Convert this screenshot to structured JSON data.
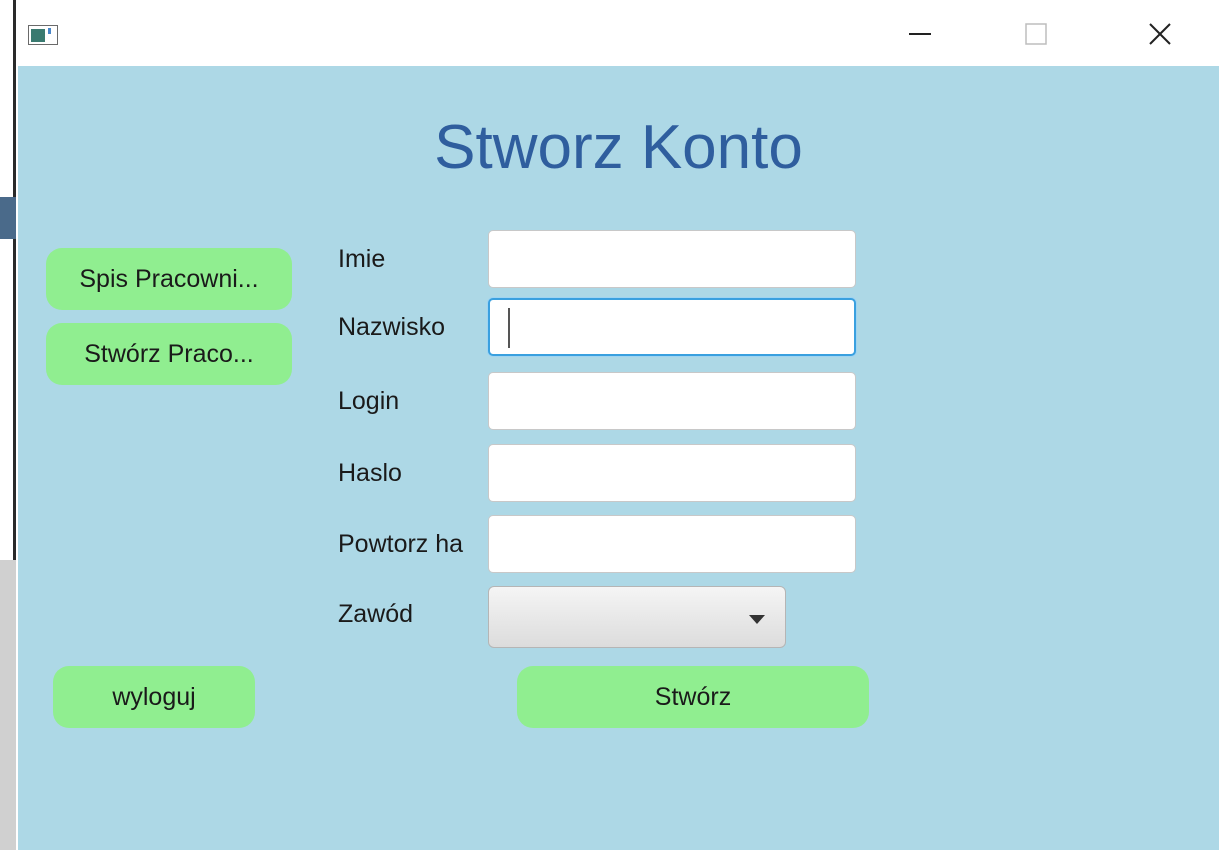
{
  "window": {
    "controls": {
      "minimize_icon": "minimize-icon",
      "maximize_icon": "maximize-icon",
      "close_icon": "close-icon"
    }
  },
  "title": "Stworz Konto",
  "sidebar": {
    "employee_list_button": "Spis Pracowni...",
    "create_employee_button": "Stwórz Praco...",
    "logout_button": "wyloguj"
  },
  "form": {
    "first_name_label": "Imie",
    "first_name_value": "",
    "last_name_label": "Nazwisko",
    "last_name_value": "",
    "login_label": "Login",
    "login_value": "",
    "password_label": "Haslo",
    "password_value": "",
    "repeat_password_label": "Powtorz ha",
    "repeat_password_value": "",
    "profession_label": "Zawód",
    "profession_value": "",
    "submit_button": "Stwórz"
  },
  "colors": {
    "background": "#add8e6",
    "button": "#90ee90",
    "title": "#2f5e9e",
    "focus": "#3aa0df"
  }
}
